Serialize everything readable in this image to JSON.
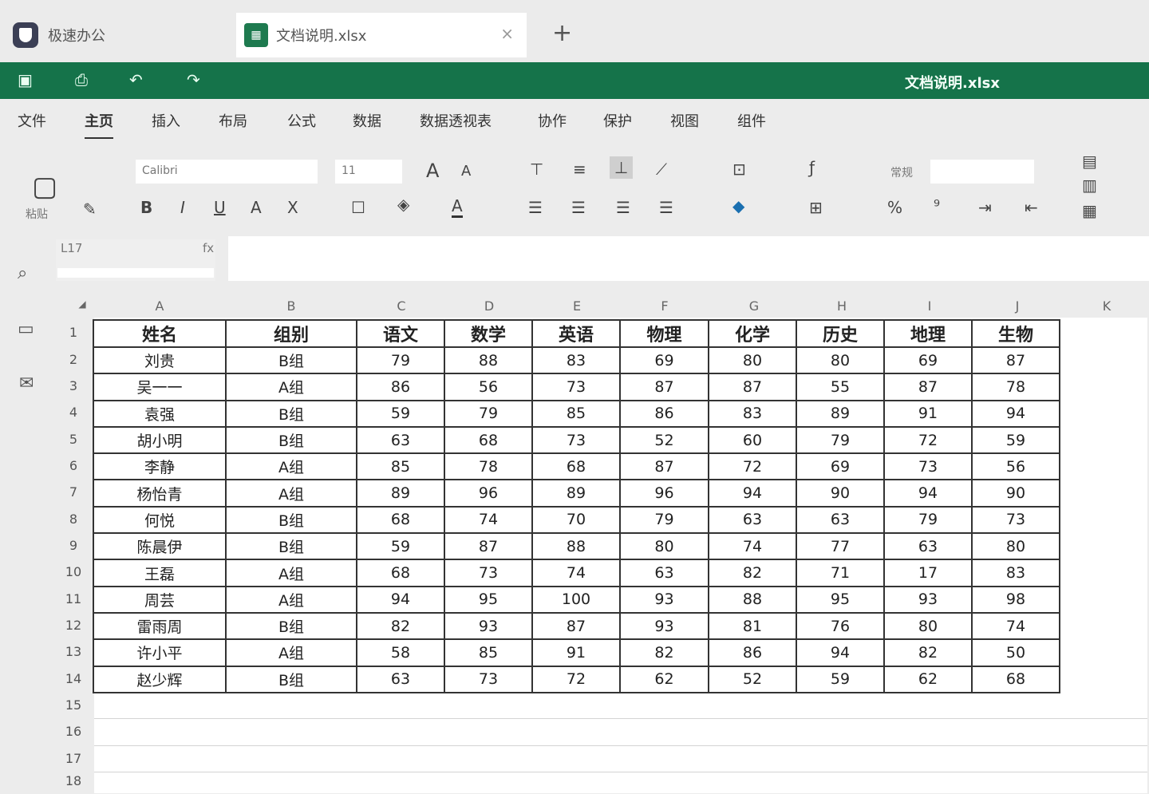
{
  "tabs": {
    "app_label": "极速办公",
    "doc_label": "文档说明.xlsx",
    "new_tab": "+",
    "close": "×"
  },
  "doc_title": "文档说明.xlsx",
  "menu": [
    "文件",
    "主页",
    "插入",
    "布局",
    "公式",
    "数据",
    "数据透视表",
    "协作",
    "保护",
    "视图",
    "组件"
  ],
  "ribbon": {
    "paste_label": "粘贴",
    "font_name": "Calibri",
    "font_size": "11",
    "style_label": "常规"
  },
  "cell_ref": "L17",
  "fx": "fx",
  "columns": [
    "A",
    "B",
    "C",
    "D",
    "E",
    "F",
    "G",
    "H",
    "I",
    "J",
    "K"
  ],
  "corner": "◢",
  "rows": [
    "1",
    "2",
    "3",
    "4",
    "5",
    "6",
    "7",
    "8",
    "9",
    "10",
    "11",
    "12",
    "13",
    "14",
    "15",
    "16",
    "17",
    "18"
  ],
  "headers": [
    "姓名",
    "组别",
    "语文",
    "数学",
    "英语",
    "物理",
    "化学",
    "历史",
    "地理",
    "生物"
  ],
  "data": [
    [
      "刘贵",
      "B组",
      "79",
      "88",
      "83",
      "69",
      "80",
      "80",
      "69",
      "87"
    ],
    [
      "吴一一",
      "A组",
      "86",
      "56",
      "73",
      "87",
      "87",
      "55",
      "87",
      "78"
    ],
    [
      "袁强",
      "B组",
      "59",
      "79",
      "85",
      "86",
      "83",
      "89",
      "91",
      "94"
    ],
    [
      "胡小明",
      "B组",
      "63",
      "68",
      "73",
      "52",
      "60",
      "79",
      "72",
      "59"
    ],
    [
      "李静",
      "A组",
      "85",
      "78",
      "68",
      "87",
      "72",
      "69",
      "73",
      "56"
    ],
    [
      "杨怡青",
      "A组",
      "89",
      "96",
      "89",
      "96",
      "94",
      "90",
      "94",
      "90"
    ],
    [
      "何悦",
      "B组",
      "68",
      "74",
      "70",
      "79",
      "63",
      "63",
      "79",
      "73"
    ],
    [
      "陈晨伊",
      "B组",
      "59",
      "87",
      "88",
      "80",
      "74",
      "77",
      "63",
      "80"
    ],
    [
      "王磊",
      "A组",
      "68",
      "73",
      "74",
      "63",
      "82",
      "71",
      "17",
      "83"
    ],
    [
      "周芸",
      "A组",
      "94",
      "95",
      "100",
      "93",
      "88",
      "95",
      "93",
      "98"
    ],
    [
      "雷雨周",
      "B组",
      "82",
      "93",
      "87",
      "93",
      "81",
      "76",
      "80",
      "74"
    ],
    [
      "许小平",
      "A组",
      "58",
      "85",
      "91",
      "82",
      "86",
      "94",
      "82",
      "50"
    ],
    [
      "赵少辉",
      "B组",
      "63",
      "73",
      "72",
      "62",
      "52",
      "59",
      "62",
      "68"
    ]
  ]
}
